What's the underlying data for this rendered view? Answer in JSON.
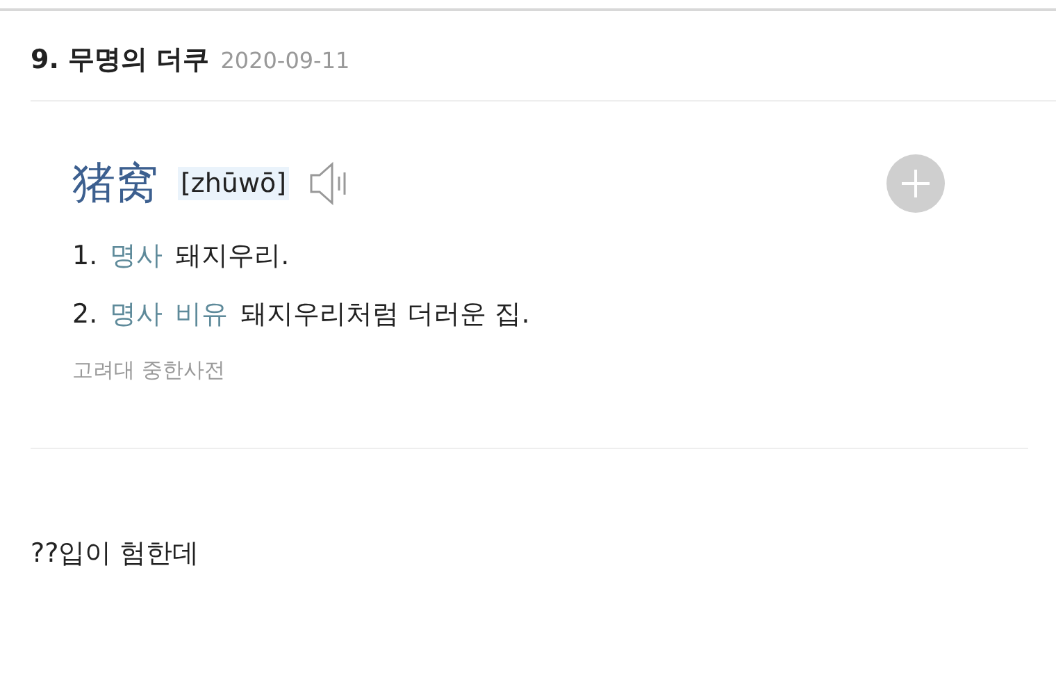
{
  "comment_header": {
    "number": "9.",
    "author": "무명의 더쿠",
    "date": "2020-09-11"
  },
  "dictionary_entry": {
    "headword": "猪窝",
    "pinyin": "[zhūwō]",
    "definitions": [
      {
        "number": "1.",
        "tags": [
          "명사"
        ],
        "text": "돼지우리."
      },
      {
        "number": "2.",
        "tags": [
          "명사",
          "비유"
        ],
        "text": "돼지우리처럼 더러운 집."
      }
    ],
    "source": "고려대 중한사전"
  },
  "comment_text": "??입이 험한데"
}
